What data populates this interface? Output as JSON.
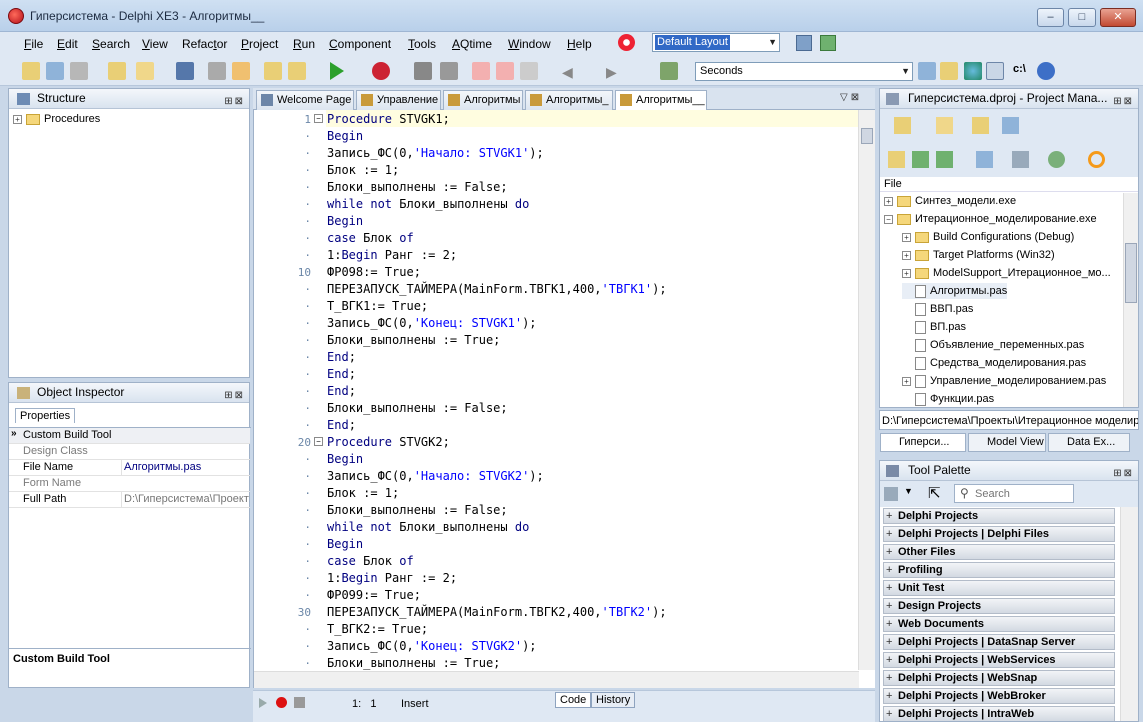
{
  "window": {
    "title": "Гиперсистема - Delphi XE3 - Алгоритмы__",
    "min": "–",
    "max": "□",
    "close": "✕"
  },
  "menu": [
    {
      "pre": "",
      "u": "F",
      "post": "ile"
    },
    {
      "pre": "",
      "u": "E",
      "post": "dit"
    },
    {
      "pre": "",
      "u": "S",
      "post": "earch"
    },
    {
      "pre": "",
      "u": "V",
      "post": "iew"
    },
    {
      "pre": "Refac",
      "u": "t",
      "post": "or"
    },
    {
      "pre": "",
      "u": "P",
      "post": "roject"
    },
    {
      "pre": "",
      "u": "R",
      "post": "un"
    },
    {
      "pre": "",
      "u": "C",
      "post": "omponent"
    },
    {
      "pre": "",
      "u": "T",
      "post": "ools"
    },
    {
      "pre": "",
      "u": "A",
      "post": "Qtime"
    },
    {
      "pre": "",
      "u": "W",
      "post": "indow"
    },
    {
      "pre": "",
      "u": "H",
      "post": "elp"
    }
  ],
  "layout_combo": "Default Layout",
  "timer_combo": "Seconds",
  "structure": {
    "title": "Structure",
    "root": "Procedures"
  },
  "object_inspector": {
    "title": "Object Inspector",
    "tab": "Properties",
    "rows": [
      {
        "name": "Custom Build Tool",
        "value": ""
      },
      {
        "name": "Design Class",
        "value": ""
      },
      {
        "name": "File Name",
        "value": "Алгоритмы.pas"
      },
      {
        "name": "Form Name",
        "value": ""
      },
      {
        "name": "Full Path",
        "value": "D:\\Гиперсистема\\Проекты"
      }
    ],
    "footer": "Custom Build Tool"
  },
  "editor": {
    "tabs": [
      "Welcome Page",
      "Управление",
      "Алгоритмы",
      "Алгоритмы_",
      "Алгоритмы__"
    ],
    "line_numbers": [
      {
        "row": 0,
        "n": "1"
      },
      {
        "row": 9,
        "n": "10"
      },
      {
        "row": 19,
        "n": "20"
      },
      {
        "row": 29,
        "n": "30"
      }
    ],
    "lines": [
      "Procedure STVGK1;",
      "Begin",
      "Запись_ФС(0,'Начало: STVGK1');",
      "Блок := 1;",
      "Блоки_выполнены := False;",
      "while not Блоки_выполнены do",
      "Begin",
      "case Блок of",
      "1:Begin Ранг := 2;",
      "ФР098:= True;",
      "ПЕРЕЗАПУСК_ТАЙМЕРА(MainForm.ТВГК1,400,'ТВГК1');",
      "Т_ВГК1:= True;",
      "Запись_ФС(0,'Конец: STVGK1');",
      "Блоки_выполнены := True;",
      "End;",
      "End;",
      "End;",
      "Блоки_выполнены := False;",
      "End;",
      "Procedure STVGK2;",
      "Begin",
      "Запись_ФС(0,'Начало: STVGK2');",
      "Блок := 1;",
      "Блоки_выполнены := False;",
      "while not Блоки_выполнены do",
      "Begin",
      "case Блок of",
      "1:Begin Ранг := 2;",
      "ФР099:= True;",
      "ПЕРЕЗАПУСК_ТАЙМЕРА(MainForm.ТВГК2,400,'ТВГК2');",
      "Т_ВГК2:= True;",
      "Запись_ФС(0,'Конец: STVGK2');",
      "Блоки_выполнены := True;"
    ],
    "status_pos": "1:   1",
    "status_mode": "Insert",
    "bottom_tabs": [
      "Code",
      "History"
    ]
  },
  "project_manager": {
    "title": "Гиперсистема.dproj - Project Mana...",
    "column": "File",
    "items": [
      {
        "label": "Синтез_модели.exe",
        "indent": 0,
        "exp": "+"
      },
      {
        "label": "Итерационное_моделирование.exe",
        "indent": 0,
        "exp": "−"
      },
      {
        "label": "Build Configurations (Debug)",
        "indent": 1,
        "exp": "+"
      },
      {
        "label": "Target Platforms (Win32)",
        "indent": 1,
        "exp": "+"
      },
      {
        "label": "ModelSupport_Итерационное_мо...",
        "indent": 1,
        "exp": "+"
      },
      {
        "label": "Алгоритмы.pas",
        "indent": 1,
        "exp": ""
      },
      {
        "label": "ВВП.pas",
        "indent": 1,
        "exp": ""
      },
      {
        "label": "ВП.pas",
        "indent": 1,
        "exp": ""
      },
      {
        "label": "Объявление_переменных.pas",
        "indent": 1,
        "exp": ""
      },
      {
        "label": "Средства_моделирования.pas",
        "indent": 1,
        "exp": ""
      },
      {
        "label": "Управление_моделированием.pas",
        "indent": 1,
        "exp": "+"
      },
      {
        "label": "Функции.pas",
        "indent": 1,
        "exp": ""
      }
    ],
    "path": "D:\\Гиперсистема\\Проекты\\Итерационное моделир",
    "tabs": [
      "Гиперси...",
      "Model View",
      "Data Ex..."
    ]
  },
  "tool_palette": {
    "title": "Tool Palette",
    "search_placeholder": "Search",
    "categories": [
      "Delphi Projects",
      "Delphi Projects | Delphi Files",
      "Other Files",
      "Profiling",
      "Unit Test",
      "Design Projects",
      "Web Documents",
      "Delphi Projects | DataSnap Server",
      "Delphi Projects | WebServices",
      "Delphi Projects | WebSnap",
      "Delphi Projects | WebBroker",
      "Delphi Projects | IntraWeb"
    ]
  }
}
